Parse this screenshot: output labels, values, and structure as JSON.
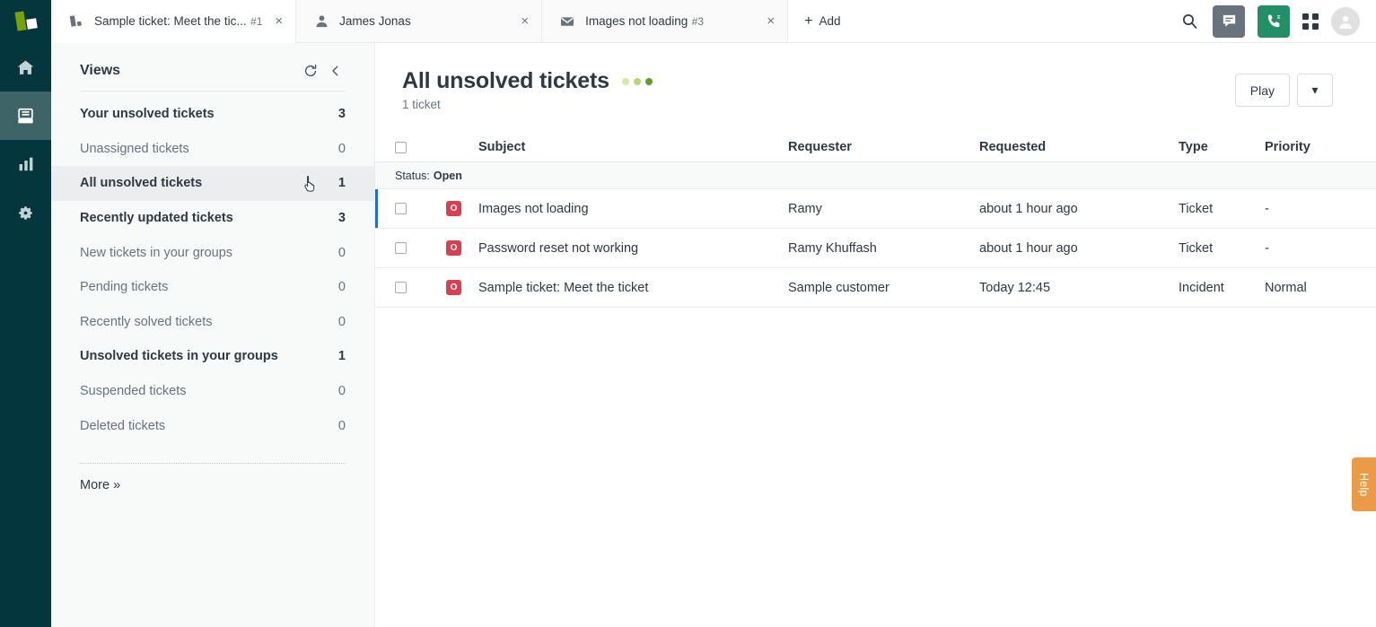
{
  "brand": {
    "logo_name": "zendesk-logo",
    "rail_color": "#03363d",
    "accent_green": "#78a300"
  },
  "topbar": {
    "tabs": [
      {
        "icon": "ticket-stack-icon",
        "title": "Sample ticket: Meet the tic...",
        "subtitle": "#1",
        "active": true,
        "close_label": "×"
      },
      {
        "icon": "user-icon",
        "title": "James Jonas",
        "subtitle": "",
        "active": false,
        "close_label": "×"
      },
      {
        "icon": "envelope-icon",
        "title": "Images not loading",
        "subtitle": "#3",
        "active": false,
        "close_label": "×"
      }
    ],
    "add_label": "Add",
    "add_plus": "+",
    "actions": {
      "search": "search-icon",
      "chat": "chat-icon",
      "talk": "phone-icon",
      "apps": "apps-grid-icon",
      "avatar": "user-avatar"
    }
  },
  "navrail": {
    "items": [
      {
        "name": "home",
        "icon": "home-icon",
        "active": false
      },
      {
        "name": "views",
        "icon": "views-inbox-icon",
        "active": true
      },
      {
        "name": "reporting",
        "icon": "bar-chart-icon",
        "active": false
      },
      {
        "name": "admin",
        "icon": "gear-icon",
        "active": false
      }
    ]
  },
  "sidebar": {
    "title": "Views",
    "refresh_icon": "refresh-icon",
    "collapse_icon": "chevron-left-icon",
    "items": [
      {
        "label": "Your unsolved tickets",
        "count": "3",
        "selected": false
      },
      {
        "label": "Unassigned tickets",
        "count": "0",
        "selected": false
      },
      {
        "label": "All unsolved tickets",
        "count": "1",
        "selected": true
      },
      {
        "label": "Recently updated tickets",
        "count": "3",
        "selected": false
      },
      {
        "label": "New tickets in your groups",
        "count": "0",
        "selected": false
      },
      {
        "label": "Pending tickets",
        "count": "0",
        "selected": false
      },
      {
        "label": "Recently solved tickets",
        "count": "0",
        "selected": false
      },
      {
        "label": "Unsolved tickets in your groups",
        "count": "1",
        "selected": false
      },
      {
        "label": "Suspended tickets",
        "count": "0",
        "selected": false
      },
      {
        "label": "Deleted tickets",
        "count": "0",
        "selected": false
      }
    ],
    "more_label": "More »"
  },
  "main": {
    "title": "All unsolved tickets",
    "subtitle": "1 ticket",
    "loading_dots": [
      "#d4e8a8",
      "#b4d86f",
      "#5e9e20"
    ],
    "play_label": "Play",
    "caret_label": "▾",
    "columns": {
      "subject": "Subject",
      "requester": "Requester",
      "requested": "Requested",
      "type": "Type",
      "priority": "Priority"
    },
    "group_label": "Status:",
    "group_value": "Open",
    "status_badge_letter": "O",
    "status_badge_color": "#d93f4c",
    "rows": [
      {
        "subject": "Images not loading",
        "requester": "Ramy",
        "requested": "about 1 hour ago",
        "type": "Ticket",
        "priority": "-",
        "marked": true
      },
      {
        "subject": "Password reset not working",
        "requester": "Ramy Khuffash",
        "requested": "about 1 hour ago",
        "type": "Ticket",
        "priority": "-",
        "marked": false
      },
      {
        "subject": "Sample ticket: Meet the ticket",
        "requester": "Sample customer",
        "requested": "Today 12:45",
        "type": "Incident",
        "priority": "Normal",
        "marked": false
      }
    ]
  },
  "help": {
    "label": "Help",
    "color": "#eb9b47"
  }
}
